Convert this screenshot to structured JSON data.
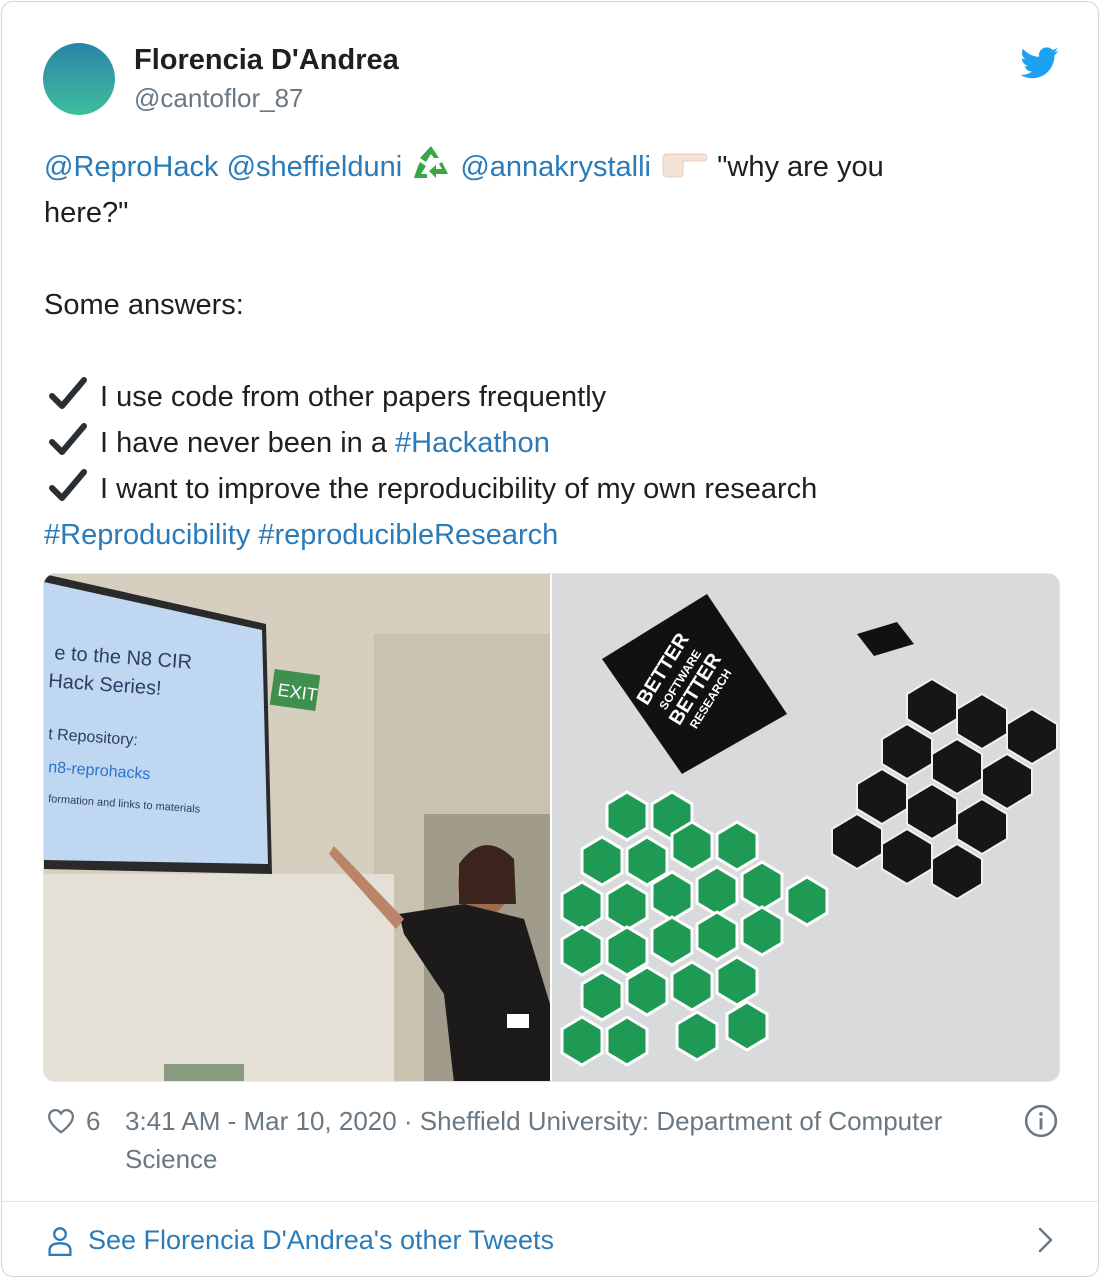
{
  "author": {
    "name": "Florencia D'Andrea",
    "handle": "@cantoflor_87"
  },
  "tweet": {
    "mentions": [
      "@ReproHack",
      "@sheffielduni",
      "@annakrystalli"
    ],
    "quote_text": "\"why are you",
    "quote_text_2": "here?\"",
    "intro": "Some answers:",
    "answers": [
      {
        "text": "I use code from other papers frequently",
        "hashtag": ""
      },
      {
        "text": "I have never been in a ",
        "hashtag": "#Hackathon"
      },
      {
        "text": "I want to improve the reproducibility of my own research",
        "hashtag": ""
      }
    ],
    "hashtags": [
      "#Reproducibility",
      "#reproducibleResearch"
    ]
  },
  "photo_left": {
    "slide_lines": [
      "e to the N8 CIR",
      "Hack Series!",
      "t Repository:",
      "n8-reprohacks",
      "formation and links to materials"
    ],
    "exit_sign": "EXIT"
  },
  "photo_right": {
    "sticker_lines": [
      "BETTER",
      "SOFTWARE",
      "BETTER",
      "RESEARCH"
    ]
  },
  "footer": {
    "likes": "6",
    "timestamp": "3:41 AM - Mar 10, 2020 · Sheffield University: Department of Computer Science",
    "see_more": "See Florencia D'Andrea's other Tweets"
  },
  "colors": {
    "link": "#2b7bb9",
    "text": "#1c2022",
    "muted": "#697882",
    "twitter_blue": "#1da1f2"
  },
  "icons": [
    "twitter-bird-icon",
    "recycle-icon",
    "pointing-hand-icon",
    "checkmark-icon",
    "heart-icon",
    "info-icon",
    "person-icon",
    "chevron-right-icon"
  ]
}
